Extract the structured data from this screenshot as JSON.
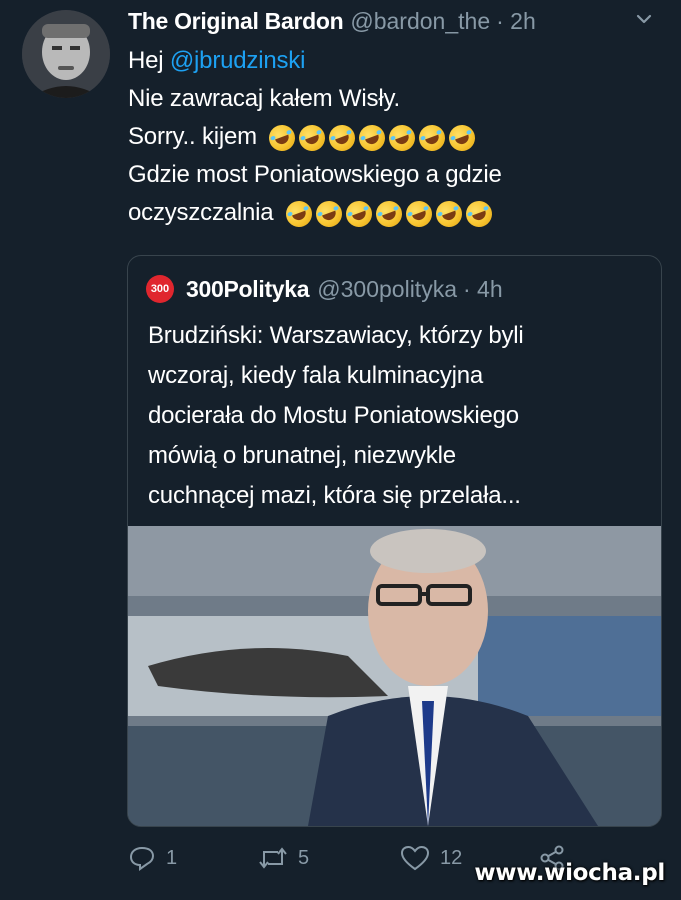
{
  "tweet": {
    "author_name": "The Original Bardon",
    "author_handle": "@bardon_the",
    "time": "· 2h",
    "lines": {
      "greeting": "Hej",
      "mention": "@jbrudzinski",
      "line2": "Nie zawracaj kałem Wisły.",
      "line3": "Sorry.. kijem",
      "line4": "Gdzie most Poniatowskiego a gdzie",
      "line5": "oczyszczalnia"
    },
    "emoji": "rolling-on-the-floor-laughing"
  },
  "quoted_tweet": {
    "logo_text": "300",
    "author_name": "300Polityka",
    "author_handle": "@300polityka",
    "time": "· 4h",
    "text_lines": [
      "Brudziński: Warszawiacy, którzy byli",
      "wczoraj, kiedy fala kulminacyjna",
      "docierała do Mostu Poniatowskiego",
      "mówią o brunatnej, niezwykle",
      "cuchnącej mazi, która się przelała..."
    ]
  },
  "actions": {
    "reply_count": "1",
    "retweet_count": "5",
    "like_count": "12"
  },
  "watermark": "www.wiocha.pl",
  "colors": {
    "background": "#15202b",
    "text": "#ffffff",
    "secondary": "#8899a6",
    "link": "#1da1f2",
    "border": "#38444d"
  }
}
